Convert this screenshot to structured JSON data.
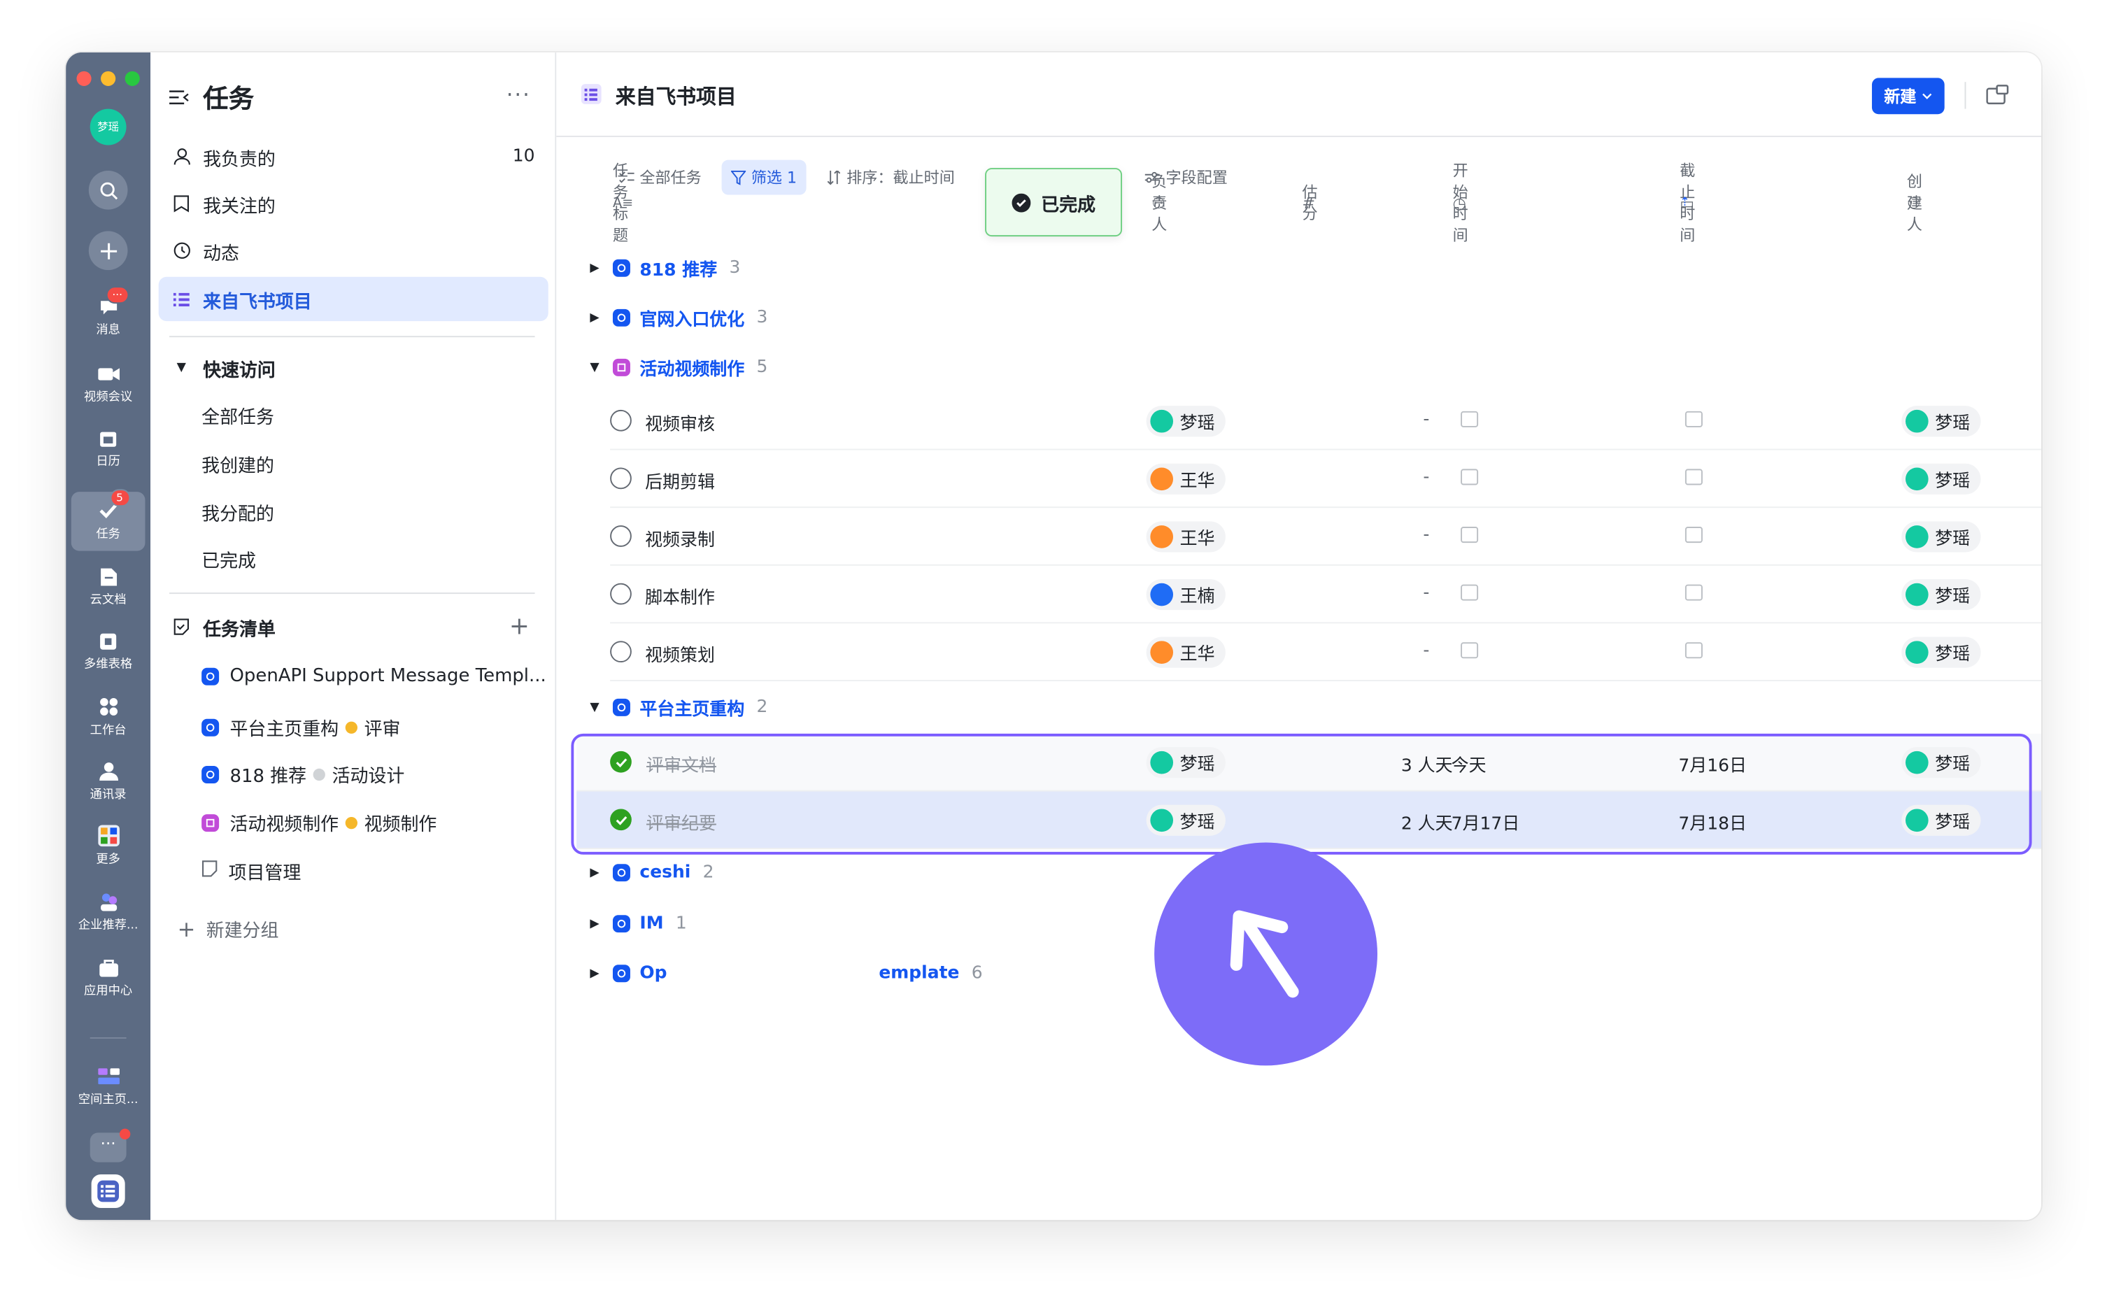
{
  "rail": {
    "avatar": "梦瑶",
    "items": [
      {
        "label": "消息",
        "icon": "message-icon",
        "badge": "···"
      },
      {
        "label": "视频会议",
        "icon": "video-icon"
      },
      {
        "label": "日历",
        "icon": "calendar-icon"
      },
      {
        "label": "任务",
        "icon": "task-icon",
        "badge": "5"
      },
      {
        "label": "云文档",
        "icon": "doc-icon"
      },
      {
        "label": "多维表格",
        "icon": "base-icon"
      },
      {
        "label": "工作台",
        "icon": "workplace-icon"
      },
      {
        "label": "通讯录",
        "icon": "contacts-icon"
      },
      {
        "label": "更多",
        "icon": "more-apps-icon"
      },
      {
        "label": "企业推荐...",
        "icon": "recommend-icon"
      },
      {
        "label": "应用中心",
        "icon": "app-center-icon"
      },
      {
        "label": "空间主页...",
        "icon": "space-home-icon"
      }
    ]
  },
  "sidebar": {
    "title": "任务",
    "more": "···",
    "items": [
      {
        "label": "我负责的",
        "count": "10"
      },
      {
        "label": "我关注的"
      },
      {
        "label": "动态"
      },
      {
        "label": "来自飞书项目"
      }
    ],
    "quick": {
      "title": "快速访问",
      "items": [
        "全部任务",
        "我创建的",
        "我分配的",
        "已完成"
      ]
    },
    "lists": {
      "title": "任务清单",
      "items": [
        {
          "label": "OpenAPI Support Message Templ...",
          "tag": ""
        },
        {
          "label": "平台主页重构",
          "tag": "评审"
        },
        {
          "label": "818 推荐",
          "tag": "活动设计"
        },
        {
          "label": "活动视频制作",
          "tag": "视频制作"
        },
        {
          "label": "项目管理",
          "tag": ""
        }
      ],
      "new_group": "新建分组"
    }
  },
  "main": {
    "title": "来自飞书项目",
    "new_button": "新建",
    "toolbar": {
      "all": "全部任务",
      "filter": "筛选 1",
      "sort": "排序：截止时间",
      "fields": "字段配置"
    },
    "tooltip": "已完成",
    "columns": {
      "title": "任务标题",
      "assignee": "负责人",
      "estimate": "估分",
      "start": "开始时间",
      "due": "截止时间",
      "creator": "创建人"
    },
    "groups": [
      {
        "name": "818 推荐",
        "count": "3"
      },
      {
        "name": "官网入口优化",
        "count": "3"
      },
      {
        "name": "活动视频制作",
        "count": "5"
      },
      {
        "name": "平台主页重构",
        "count": "2"
      },
      {
        "name": "ceshi",
        "count": "2"
      },
      {
        "name": "IM",
        "count": "1"
      },
      {
        "name": "Op",
        "count": ""
      },
      {
        "name": "emplate",
        "count": "6"
      }
    ],
    "video_tasks": [
      {
        "title": "视频审核",
        "assignee": "梦瑶",
        "start": "-",
        "creator": "梦瑶"
      },
      {
        "title": "后期剪辑",
        "assignee": "王华",
        "start": "-",
        "creator": "梦瑶"
      },
      {
        "title": "视频录制",
        "assignee": "王华",
        "start": "-",
        "creator": "梦瑶"
      },
      {
        "title": "脚本制作",
        "assignee": "王楠",
        "start": "-",
        "creator": "梦瑶"
      },
      {
        "title": "视频策划",
        "assignee": "王华",
        "start": "-",
        "creator": "梦瑶"
      }
    ],
    "platform_tasks": [
      {
        "title": "评审文档",
        "assignee": "梦瑶",
        "estimate": "3 人天",
        "start": "今天",
        "due": "7月16日",
        "creator": "梦瑶"
      },
      {
        "title": "评审纪要",
        "assignee": "梦瑶",
        "estimate": "2 人天",
        "start": "7月17日",
        "due": "7月18日",
        "creator": "梦瑶"
      }
    ]
  },
  "colors": {
    "accent": "#1456f0",
    "rail": "#5c6b83",
    "highlight": "#7b5cff",
    "cursor": "#7d6cf8",
    "done": "#2ea121",
    "avatar_teal": "#14c9a1",
    "avatar_orange": "#ff8c2a",
    "avatar_blue": "#1f6cf5"
  }
}
